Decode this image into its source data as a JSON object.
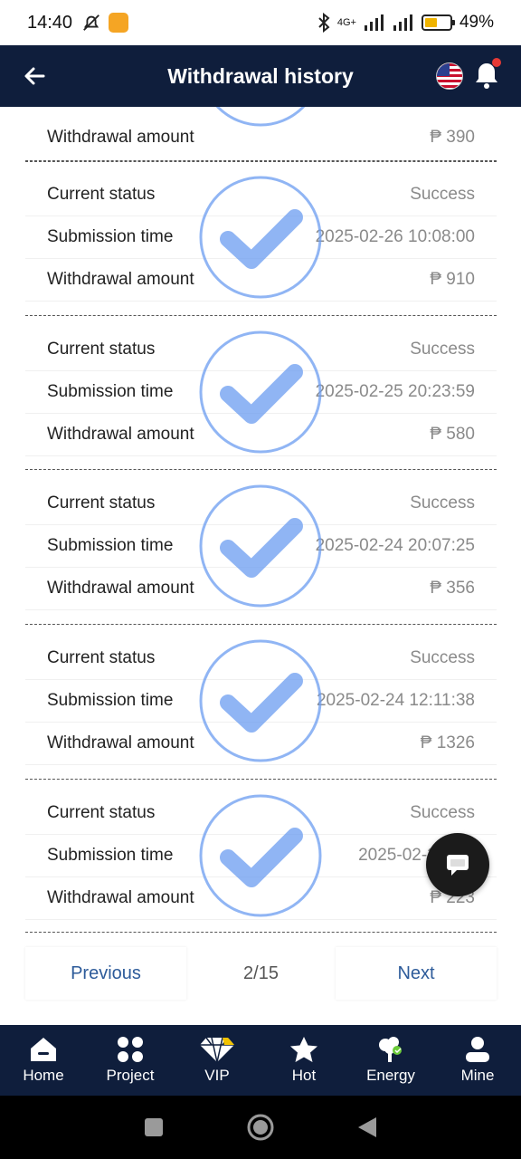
{
  "status_bar": {
    "time": "14:40",
    "network": "4G+",
    "battery": "49%"
  },
  "header": {
    "title": "Withdrawal history"
  },
  "labels": {
    "status": "Current status",
    "time": "Submission time",
    "amount": "Withdrawal amount"
  },
  "partial_record": {
    "amount": "₱ 390"
  },
  "records": [
    {
      "status": "Success",
      "time": "2025-02-26 10:08:00",
      "amount": "₱ 910"
    },
    {
      "status": "Success",
      "time": "2025-02-25 20:23:59",
      "amount": "₱ 580"
    },
    {
      "status": "Success",
      "time": "2025-02-24 20:07:25",
      "amount": "₱ 356"
    },
    {
      "status": "Success",
      "time": "2025-02-24 12:11:38",
      "amount": "₱ 1326"
    },
    {
      "status": "Success",
      "time": "2025-02-23 20:",
      "amount": "₱ 223"
    }
  ],
  "pagination": {
    "previous": "Previous",
    "page": "2/15",
    "next": "Next"
  },
  "bottom_nav": [
    {
      "label": "Home",
      "icon": "home-icon"
    },
    {
      "label": "Project",
      "icon": "grid-icon"
    },
    {
      "label": "VIP",
      "icon": "diamond-icon"
    },
    {
      "label": "Hot",
      "icon": "star-icon"
    },
    {
      "label": "Energy",
      "icon": "tree-icon"
    },
    {
      "label": "Mine",
      "icon": "user-icon"
    }
  ],
  "colors": {
    "header_bg": "#0f1e3c",
    "accent": "#2d5b9a",
    "stamp": "#6b9cf0"
  }
}
